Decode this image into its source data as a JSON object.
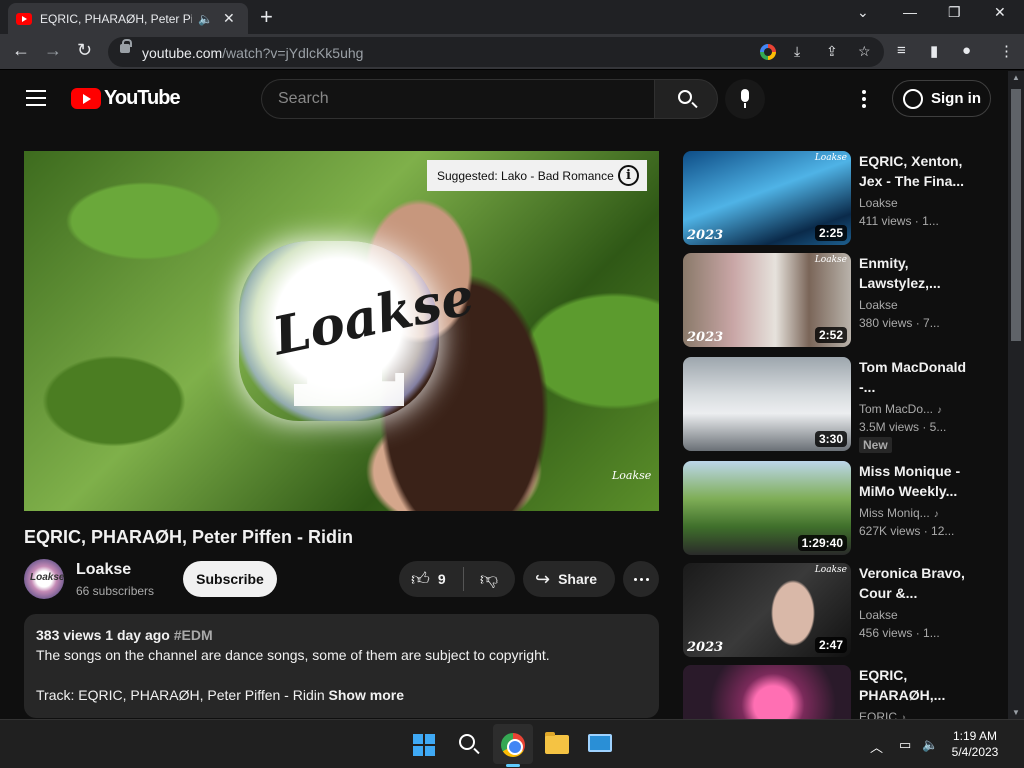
{
  "browser": {
    "tab_title": "EQRIC, PHARAØH, Peter Piffen - Ridin",
    "tab_audio_icon": "speaker-icon",
    "new_tab_label": "+",
    "window_controls": {
      "chevron": "⌄",
      "minimize": "—",
      "restore": "❐",
      "close": "✕"
    },
    "url_host": "youtube.com",
    "url_path": "/watch?v=jYdlcKk5uhg"
  },
  "youtube": {
    "logo_text": "YouTube",
    "search_placeholder": "Search",
    "signin_label": "Sign in"
  },
  "player": {
    "suggested_label": "Suggested: Lako - Bad Romance",
    "info_glyph": "i",
    "overlay_brand": "Loakse",
    "watermark": "Loakse"
  },
  "video": {
    "title": "EQRIC, PHARAØH, Peter Piffen - Ridin",
    "channel_name": "Loakse",
    "channel_avatar_text": "Loakse",
    "subscribers": "66 subscribers",
    "subscribe_label": "Subscribe",
    "like_count": "9",
    "share_label": "Share",
    "views_date": "383 views  1 day ago",
    "hashtag": "#EDM",
    "description_line": "The songs on the channel are dance songs, some of them are subject to copyright.",
    "track_line": "Track: EQRIC, PHARAØH, Peter Piffen - Ridin",
    "show_more": "Show more"
  },
  "recommendations": [
    {
      "title": "EQRIC, Xenton, Jex - The Fina...",
      "channel": "Loakse",
      "views": "411 views · 1...",
      "duration": "2:25",
      "year": "2023",
      "brand": "Loakse"
    },
    {
      "title": "Enmity, Lawstylez,...",
      "channel": "Loakse",
      "views": "380 views · 7...",
      "duration": "2:52",
      "year": "2023",
      "brand": "Loakse"
    },
    {
      "title": "Tom MacDonald -...",
      "channel": "Tom MacDo...",
      "views": "3.5M views · 5...",
      "duration": "3:30",
      "badge": "New"
    },
    {
      "title": "Miss Monique - MiMo Weekly...",
      "channel": "Miss Moniq...",
      "views": "627K views · 12...",
      "duration": "1:29:40"
    },
    {
      "title": "Veronica Bravo, Cour &...",
      "channel": "Loakse",
      "views": "456 views · 1...",
      "duration": "2:47",
      "year": "2023",
      "brand": "Loakse"
    },
    {
      "title": "EQRIC, PHARAØH,...",
      "channel": "EQRIC"
    }
  ],
  "taskbar": {
    "time": "1:19 AM",
    "date": "5/4/2023"
  }
}
